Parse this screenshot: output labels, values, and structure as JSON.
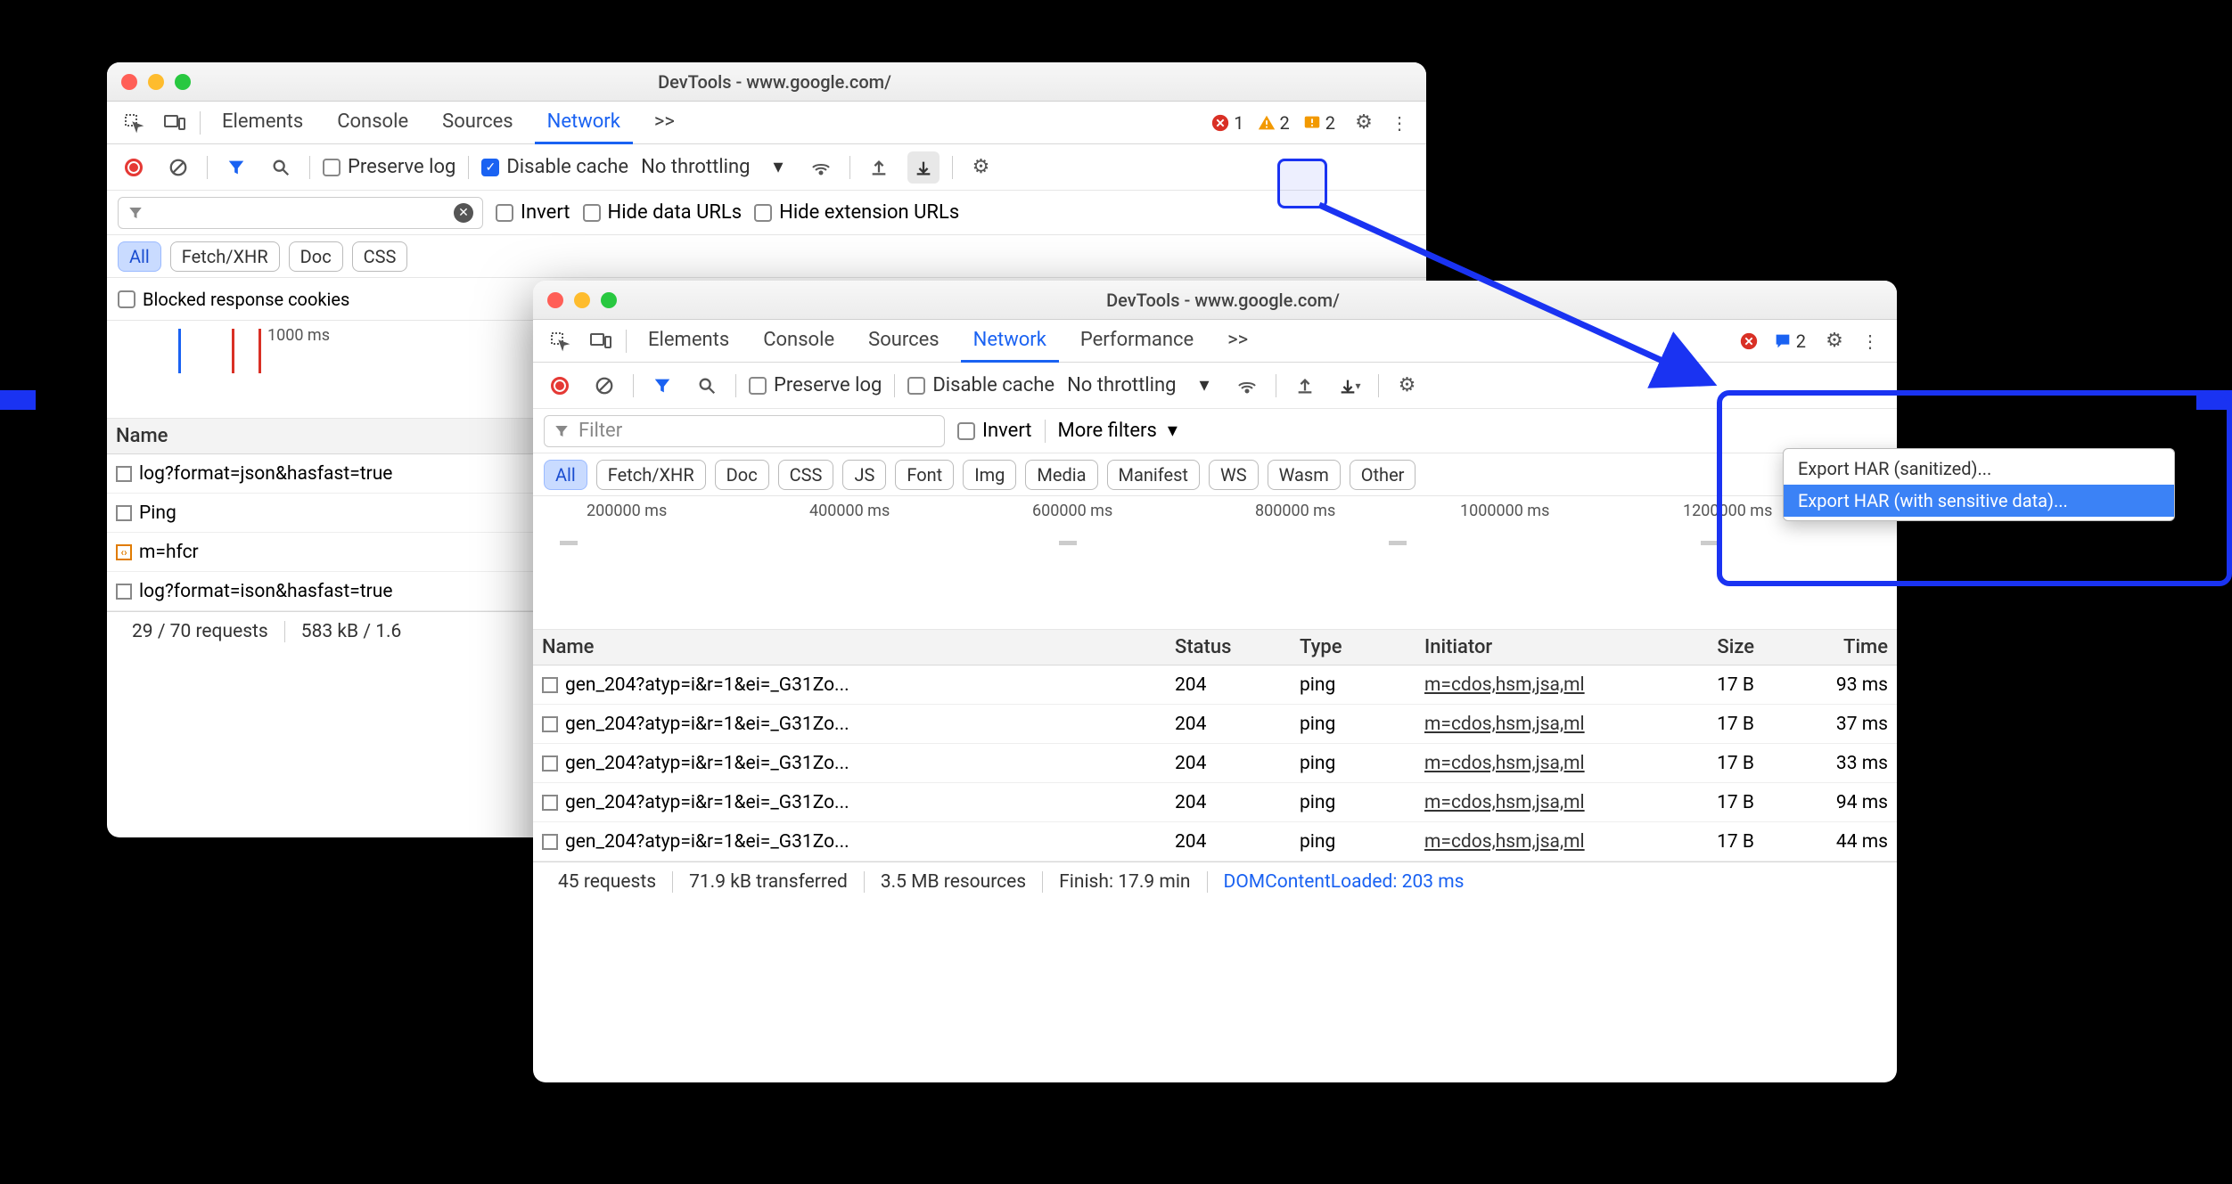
{
  "window1": {
    "title": "DevTools - www.google.com/",
    "tabs": [
      "Elements",
      "Console",
      "Sources",
      "Network"
    ],
    "activeTab": "Network",
    "moreTabs": ">>",
    "errCount": "1",
    "warnCount": "2",
    "issueCount": "2",
    "toolbar": {
      "preserve": "Preserve log",
      "disableCache": "Disable cache",
      "throttling": "No throttling"
    },
    "filterbar": {
      "invert": "Invert",
      "hideData": "Hide data URLs",
      "hideExt": "Hide extension URLs"
    },
    "types": [
      "All",
      "Fetch/XHR",
      "Doc",
      "CSS"
    ],
    "blocked": "Blocked response cookies",
    "wfTime": "1000 ms",
    "nameHeader": "Name",
    "rows": [
      "log?format=json&hasfast=true",
      "Ping",
      "m=hfcr",
      "log?format=ison&hasfast=true"
    ],
    "status": {
      "requests": "29 / 70 requests",
      "transferred": "583 kB / 1.6"
    }
  },
  "window2": {
    "title": "DevTools - www.google.com/",
    "tabs": [
      "Elements",
      "Console",
      "Sources",
      "Network",
      "Performance"
    ],
    "activeTab": "Network",
    "moreTabs": ">>",
    "issueCount": "2",
    "toolbar": {
      "preserve": "Preserve log",
      "disableCache": "Disable cache",
      "throttling": "No throttling"
    },
    "filter": "Filter",
    "invert": "Invert",
    "moreFilters": "More filters",
    "types": [
      "All",
      "Fetch/XHR",
      "Doc",
      "CSS",
      "JS",
      "Font",
      "Img",
      "Media",
      "Manifest",
      "WS",
      "Wasm",
      "Other"
    ],
    "wfTimes": [
      "200000 ms",
      "400000 ms",
      "600000 ms",
      "800000 ms",
      "1000000 ms",
      "1200000 ms"
    ],
    "columns": [
      "Name",
      "Status",
      "Type",
      "Initiator",
      "Size",
      "Time"
    ],
    "rows": [
      {
        "name": "gen_204?atyp=i&r=1&ei=_G31Zo...",
        "status": "204",
        "type": "ping",
        "init": "m=cdos,hsm,jsa,ml",
        "size": "17 B",
        "time": "93 ms"
      },
      {
        "name": "gen_204?atyp=i&r=1&ei=_G31Zo...",
        "status": "204",
        "type": "ping",
        "init": "m=cdos,hsm,jsa,ml",
        "size": "17 B",
        "time": "37 ms"
      },
      {
        "name": "gen_204?atyp=i&r=1&ei=_G31Zo...",
        "status": "204",
        "type": "ping",
        "init": "m=cdos,hsm,jsa,ml",
        "size": "17 B",
        "time": "33 ms"
      },
      {
        "name": "gen_204?atyp=i&r=1&ei=_G31Zo...",
        "status": "204",
        "type": "ping",
        "init": "m=cdos,hsm,jsa,ml",
        "size": "17 B",
        "time": "94 ms"
      },
      {
        "name": "gen_204?atyp=i&r=1&ei=_G31Zo...",
        "status": "204",
        "type": "ping",
        "init": "m=cdos,hsm,jsa,ml",
        "size": "17 B",
        "time": "44 ms"
      }
    ],
    "status": {
      "requests": "45 requests",
      "transferred": "71.9 kB transferred",
      "resources": "3.5 MB resources",
      "finish": "Finish: 17.9 min",
      "dcl": "DOMContentLoaded: 203 ms"
    }
  },
  "contextMenu": {
    "item1": "Export HAR (sanitized)...",
    "item2": "Export HAR (with sensitive data)..."
  }
}
